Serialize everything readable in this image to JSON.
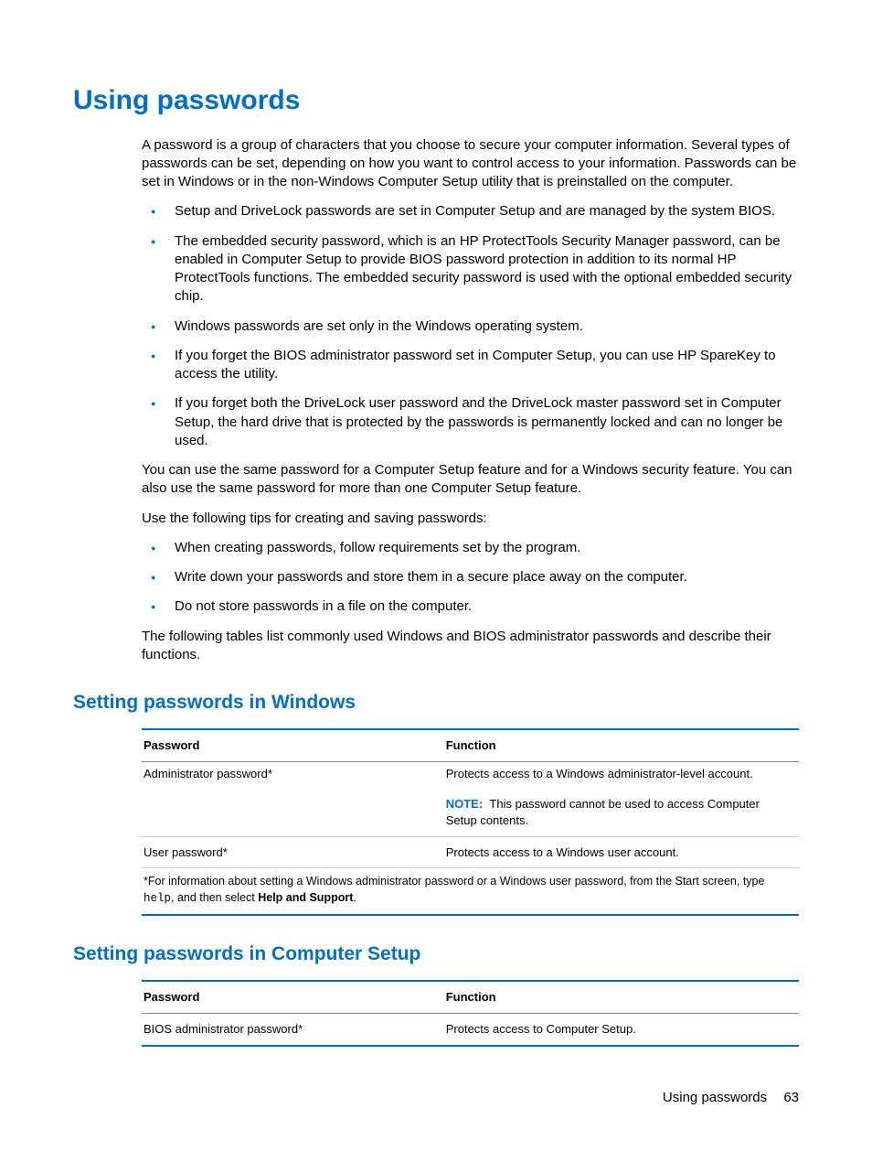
{
  "heading": "Using passwords",
  "intro": "A password is a group of characters that you choose to secure your computer information. Several types of passwords can be set, depending on how you want to control access to your information. Passwords can be set in Windows or in the non-Windows Computer Setup utility that is preinstalled on the computer.",
  "bullets1": [
    "Setup and DriveLock passwords are set in Computer Setup and are managed by the system BIOS.",
    "The embedded security password, which is an HP ProtectTools Security Manager password, can be enabled in Computer Setup to provide BIOS password protection in addition to its normal HP ProtectTools functions. The embedded security password is used with the optional embedded security chip.",
    "Windows passwords are set only in the Windows operating system.",
    "If you forget the BIOS administrator password set in Computer Setup, you can use HP SpareKey to access the utility.",
    "If you forget both the DriveLock user password and the DriveLock master password set in Computer Setup, the hard drive that is protected by the passwords is permanently locked and can no longer be used."
  ],
  "para2": "You can use the same password for a Computer Setup feature and for a Windows security feature. You can also use the same password for more than one Computer Setup feature.",
  "para3": "Use the following tips for creating and saving passwords:",
  "bullets2": [
    "When creating passwords, follow requirements set by the program.",
    "Write down your passwords and store them in a secure place away on the computer.",
    "Do not store passwords in a file on the computer."
  ],
  "para4": "The following tables list commonly used Windows and BIOS administrator passwords and describe their functions.",
  "section_windows": "Setting passwords in Windows",
  "tbl_hdr_pass": "Password",
  "tbl_hdr_func": "Function",
  "win_row1_pass": "Administrator password*",
  "win_row1_func": "Protects access to a Windows administrator-level account.",
  "note_label": "NOTE:",
  "win_row1_note": "This password cannot be used to access Computer Setup contents.",
  "win_row2_pass": "User password*",
  "win_row2_func": "Protects access to a Windows user account.",
  "win_footnote_a": "*For information about setting a Windows administrator password or a Windows user password, from the Start screen, type ",
  "win_footnote_code": "help",
  "win_footnote_b": ", and then select ",
  "win_footnote_bold": "Help and Support",
  "win_footnote_c": ".",
  "section_cs": "Setting passwords in Computer Setup",
  "cs_row1_pass": "BIOS administrator password*",
  "cs_row1_func": "Protects access to Computer Setup.",
  "footer_text": "Using passwords",
  "page_number": "63"
}
